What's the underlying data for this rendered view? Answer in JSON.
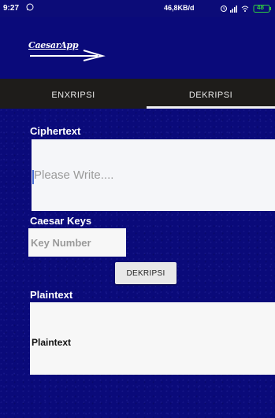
{
  "status_bar": {
    "time": "9:27",
    "network_speed": "46,8KB/d",
    "battery": "48",
    "icons": [
      "whatsapp-icon",
      "alarm-icon",
      "signal-icon",
      "wifi-icon",
      "battery-icon"
    ]
  },
  "app_bar": {
    "logo_text": "CaesarApp"
  },
  "tabs": [
    {
      "label": "ENXRIPSI",
      "selected": false
    },
    {
      "label": "DEKRIPSI",
      "selected": true
    }
  ],
  "ciphertext": {
    "label": "Ciphertext",
    "value": "",
    "placeholder": "Please Write...."
  },
  "caesar_keys": {
    "label": "Caesar Keys",
    "value": "",
    "placeholder": "Key Number"
  },
  "action_button": {
    "label": "DEKRIPSI"
  },
  "plaintext": {
    "label": "Plaintext",
    "value": "Plaintext"
  },
  "colors": {
    "background": "#0a0a7a",
    "tab_bar": "#1e1c1a",
    "field_background": "#f5f6f9"
  }
}
